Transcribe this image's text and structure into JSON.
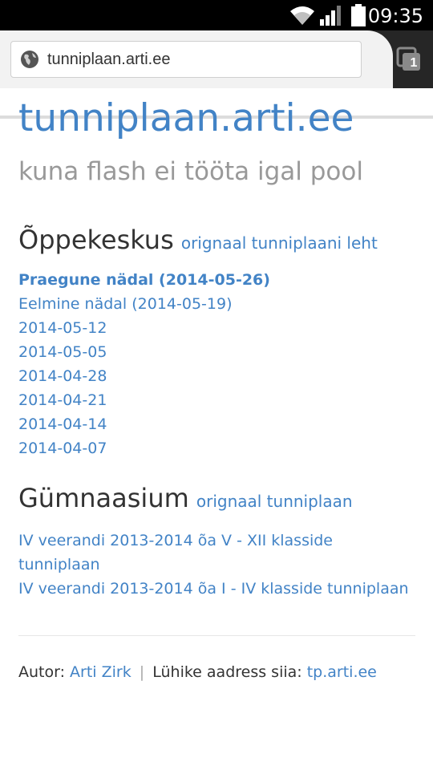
{
  "status_bar": {
    "time": "09:35",
    "icons": [
      "wifi-icon",
      "signal-icon",
      "battery-icon"
    ]
  },
  "browser": {
    "url": "tunniplaan.arti.ee",
    "tab_count": "1"
  },
  "page": {
    "title": "tunniplaan.arti.ee",
    "tagline": "kuna flash ei tööta igal pool",
    "oppekeskus": {
      "heading": "Õppekeskus",
      "link": "orignaal tunniplaani leht",
      "weeks": [
        "Praegune nädal (2014-05-26)",
        "Eelmine nädal (2014-05-19)",
        "2014-05-12",
        "2014-05-05",
        "2014-04-28",
        "2014-04-21",
        "2014-04-14",
        "2014-04-07"
      ]
    },
    "gymnaasium": {
      "heading": "Gümnaasium",
      "link": "orignaal tunniplaan",
      "items": [
        "IV veerandi 2013-2014 õa V - XII klasside",
        "tunniplaan",
        "IV veerandi 2013-2014 õa I - IV klasside tunniplaan"
      ]
    },
    "footer": {
      "author_label": "Autor:",
      "author_name": "Arti Zirk",
      "separator": "|",
      "short_label": "Lühike aadress siia:",
      "short_link": "tp.arti.ee"
    }
  },
  "colors": {
    "link": "#4283c6",
    "tagline": "#999999",
    "text": "#333333"
  }
}
